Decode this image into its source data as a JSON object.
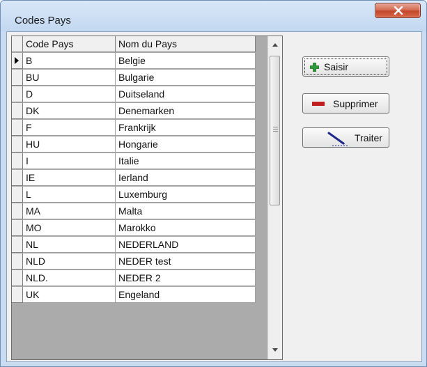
{
  "window": {
    "title": "Codes Pays"
  },
  "grid": {
    "columns": [
      "Code Pays",
      "Nom du Pays"
    ],
    "rows": [
      [
        "B",
        "Belgie"
      ],
      [
        "BU",
        "Bulgarie"
      ],
      [
        "D",
        "Duitseland"
      ],
      [
        "DK",
        "Denemarken"
      ],
      [
        "F",
        "Frankrijk"
      ],
      [
        "HU",
        "Hongarie"
      ],
      [
        "I",
        "Italie"
      ],
      [
        "IE",
        "Ierland"
      ],
      [
        "L",
        "Luxemburg"
      ],
      [
        "MA",
        "Malta"
      ],
      [
        "MO",
        "Marokko"
      ],
      [
        "NL",
        "NEDERLAND"
      ],
      [
        "NLD",
        "NEDER test"
      ],
      [
        "NLD.",
        "NEDER 2"
      ],
      [
        "UK",
        "Engeland"
      ]
    ],
    "current_row": 0
  },
  "buttons": {
    "saisir": "Saisir",
    "supprimer": "Supprimer",
    "traiter": "Traiter"
  },
  "icons": {
    "saisir": "green-plus-icon",
    "supprimer": "red-minus-icon",
    "traiter": "pen-icon",
    "close": "close-icon"
  }
}
